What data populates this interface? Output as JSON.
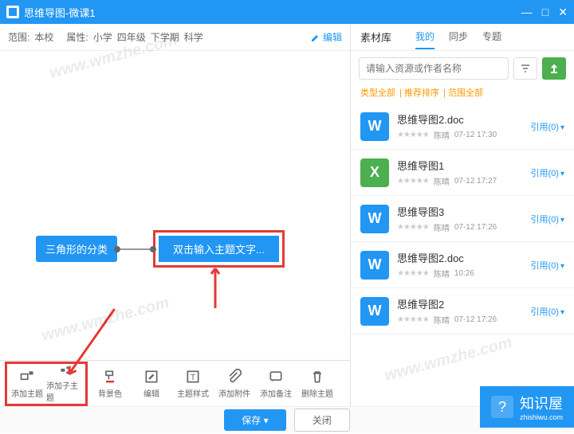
{
  "titlebar": {
    "title": "思维导图-微课1"
  },
  "meta": {
    "scope_label": "范围:",
    "scope_value": "本校",
    "attr_label": "属性:",
    "attr_value": "小学",
    "grade": "四年级",
    "term": "下学期",
    "subject": "科学",
    "edit": "编辑"
  },
  "mindmap": {
    "root": "三角形的分类",
    "child_placeholder": "双击输入主题文字..."
  },
  "toolbar": [
    {
      "key": "add-topic",
      "label": "添加主题"
    },
    {
      "key": "add-subtopic",
      "label": "添加子主题"
    },
    {
      "key": "bg-color",
      "label": "背景色"
    },
    {
      "key": "edit",
      "label": "编辑"
    },
    {
      "key": "topic-style",
      "label": "主题样式"
    },
    {
      "key": "add-attachment",
      "label": "添加附件"
    },
    {
      "key": "add-note",
      "label": "添加备注"
    },
    {
      "key": "delete-topic",
      "label": "删除主题"
    }
  ],
  "panel": {
    "title": "素材库",
    "tabs": {
      "mine": "我的",
      "sync": "同步",
      "special": "专题"
    },
    "search_placeholder": "请输入资源或作者名称",
    "filters": {
      "type": "类型全部",
      "sort": "推荐排序",
      "scope": "范围全部"
    }
  },
  "resources": [
    {
      "icon": "W",
      "type": "word",
      "name": "思维导图2.doc",
      "author": "陈晴",
      "time": "07-12 17:30",
      "ref": "引用(0)"
    },
    {
      "icon": "X",
      "type": "excel",
      "name": "思维导图1",
      "author": "陈晴",
      "time": "07-12 17:27",
      "ref": "引用(0)"
    },
    {
      "icon": "W",
      "type": "word",
      "name": "思维导图3",
      "author": "陈晴",
      "time": "07-12 17:26",
      "ref": "引用(0)"
    },
    {
      "icon": "W",
      "type": "word",
      "name": "思维导图2.doc",
      "author": "陈晴",
      "time": "10:26",
      "ref": "引用(0)"
    },
    {
      "icon": "W",
      "type": "word",
      "name": "思维导图2",
      "author": "陈晴",
      "time": "07-12 17:26",
      "ref": "引用(0)"
    }
  ],
  "footer": {
    "save": "保存",
    "close": "关闭",
    "dropdown": "▾"
  },
  "brand": {
    "name": "知识屋",
    "sub": "zhishiwu.com"
  },
  "watermark": "www.wmzhe.com"
}
